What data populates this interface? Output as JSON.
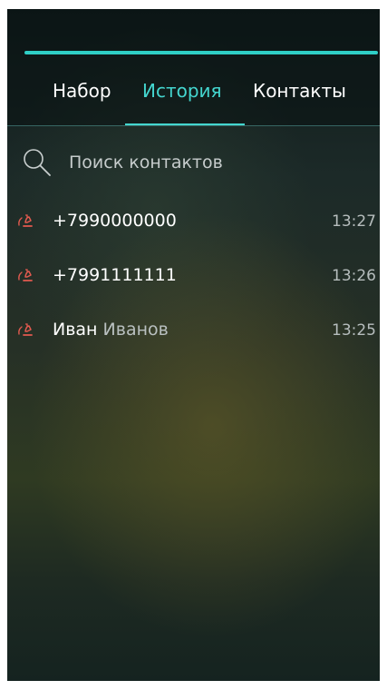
{
  "tabs": {
    "dial": "Набор",
    "history": "История",
    "contacts": "Контакты"
  },
  "search": {
    "placeholder": "Поиск контактов",
    "icon": "search-icon"
  },
  "calls": [
    {
      "first": "+7990000000",
      "last": "",
      "time": "13:27",
      "type": "missed",
      "icon": "missed-call-icon"
    },
    {
      "first": "+7991111111",
      "last": "",
      "time": "13:26",
      "type": "missed",
      "icon": "missed-call-icon"
    },
    {
      "first": "Иван",
      "last": "Иванов",
      "time": "13:25",
      "type": "missed",
      "icon": "missed-call-icon"
    }
  ],
  "colors": {
    "accent": "#44d6cf",
    "missed_call": "#e25a4f",
    "text": "#ffffff",
    "secondary_text": "#b6bdbd"
  }
}
